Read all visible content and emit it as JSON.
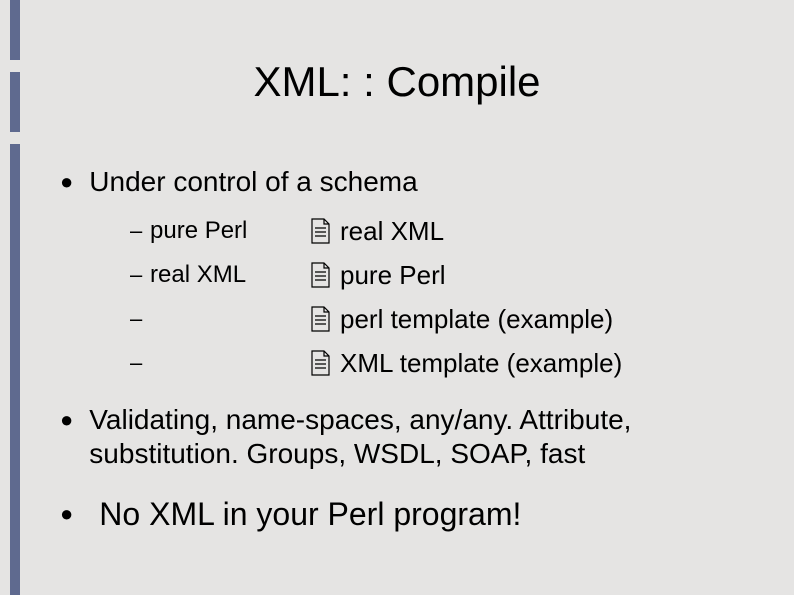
{
  "title": "XML: : Compile",
  "bullet1": "Under control of a schema",
  "sub": [
    {
      "left": "pure Perl",
      "right": "real XML"
    },
    {
      "left": "real XML",
      "right": "pure Perl"
    },
    {
      "left": "",
      "right": "perl template (example)"
    },
    {
      "left": "",
      "right": "XML template (example)"
    }
  ],
  "bullet2": "Validating, name-spaces, any/any. Attribute, substitution. Groups, WSDL, SOAP, fast",
  "bullet3": "No XML in your Perl program!"
}
